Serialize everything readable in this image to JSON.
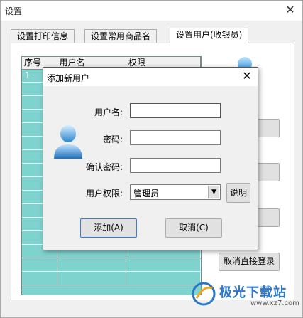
{
  "main_window": {
    "title": "设置",
    "close_glyph": "✕"
  },
  "tabs": [
    {
      "label": "设置打印信息"
    },
    {
      "label": "设置常用商品名"
    },
    {
      "label": "设置用户(收银员)"
    }
  ],
  "grid": {
    "columns": [
      "序号",
      "用户名",
      "权限"
    ],
    "rows": [
      {
        "index": "1",
        "username": "",
        "permission": ""
      }
    ]
  },
  "side_buttons": {
    "b1": "...",
    "b2": "...",
    "b3": "",
    "b4": "取消直接登录"
  },
  "dialog": {
    "title": "添加新用户",
    "close_glyph": "✕",
    "labels": {
      "username": "用户名:",
      "password": "密码:",
      "confirm": "确认密码:",
      "permission": "用户权限:"
    },
    "fields": {
      "username_value": "",
      "password_value": "",
      "confirm_value": ""
    },
    "permission_select": {
      "selected": "管理员"
    },
    "explain_button": "说明",
    "add_button": "添加(A)",
    "cancel_button": "取消(C)"
  },
  "watermark": {
    "text": "极光下载站",
    "url": "www.xz7.com"
  },
  "colors": {
    "grid_bg": "#7fd3cf",
    "accent": "#3a7bd5"
  },
  "icons": {
    "user_avatar": "user-avatar-icon",
    "select_arrow": "chevron-down-icon"
  }
}
